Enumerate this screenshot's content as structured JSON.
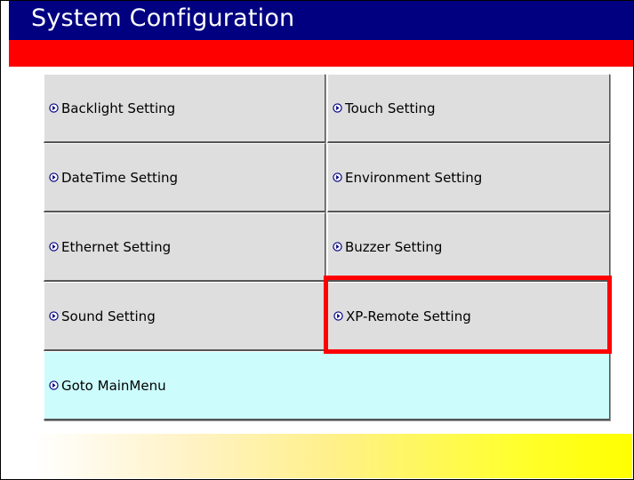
{
  "window": {
    "title": "System Configuration"
  },
  "menu": {
    "left": [
      {
        "label": "Backlight Setting"
      },
      {
        "label": "DateTime Setting"
      },
      {
        "label": "Ethernet Setting"
      },
      {
        "label": "Sound Setting"
      }
    ],
    "right": [
      {
        "label": "Touch Setting"
      },
      {
        "label": "Environment Setting"
      },
      {
        "label": "Buzzer Setting"
      },
      {
        "label": "XP-Remote Setting"
      }
    ],
    "goto_main": {
      "label": "Goto MainMenu"
    }
  },
  "icons": {
    "button_icon": "circle-arrow-right-icon"
  },
  "colors": {
    "title_bar": "#000080",
    "accent_bar": "#ff0000",
    "button_bg": "#dedede",
    "main_menu_bg": "#ccfcfc",
    "highlight": "#ff0000",
    "footer_gradient_end": "#ffff00"
  }
}
